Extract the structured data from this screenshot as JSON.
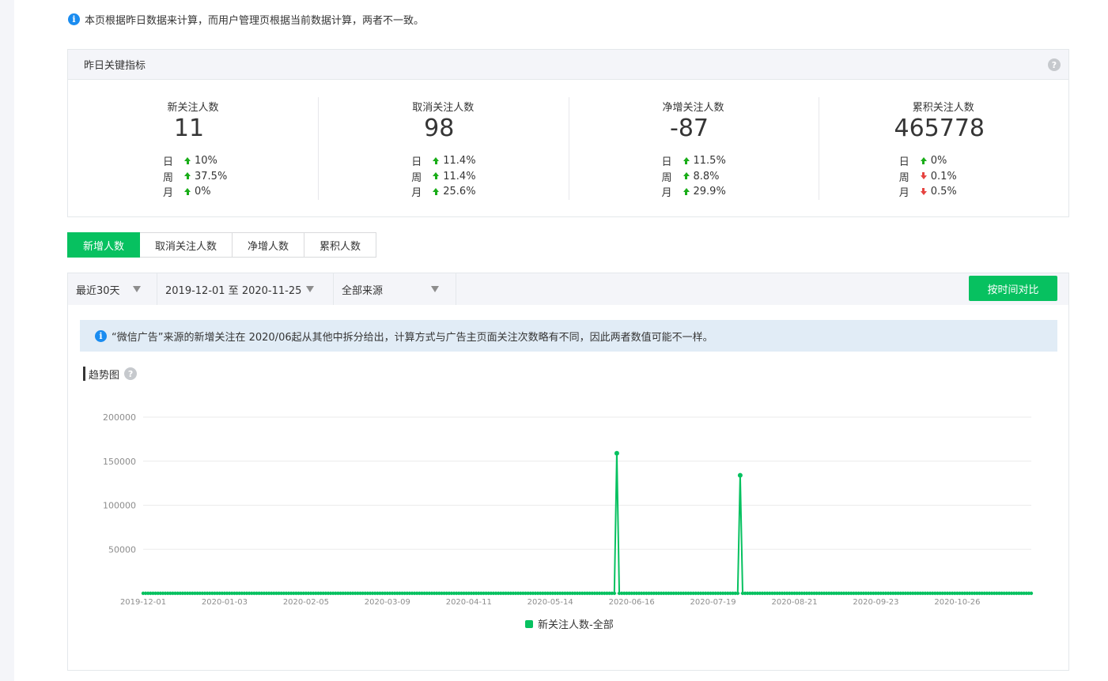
{
  "notice": {
    "text": "本页根据昨日数据来计算，而用户管理页根据当前数据计算，两者不一致。",
    "icon": "info-icon"
  },
  "kpi": {
    "title": "昨日关键指标",
    "help_icon": "question-icon",
    "metrics": [
      {
        "label": "新关注人数",
        "value": "11",
        "stats": [
          {
            "period": "日",
            "direction": "up",
            "change": "10%"
          },
          {
            "period": "周",
            "direction": "up",
            "change": "37.5%"
          },
          {
            "period": "月",
            "direction": "up",
            "change": "0%"
          }
        ]
      },
      {
        "label": "取消关注人数",
        "value": "98",
        "stats": [
          {
            "period": "日",
            "direction": "up",
            "change": "11.4%"
          },
          {
            "period": "周",
            "direction": "up",
            "change": "11.4%"
          },
          {
            "period": "月",
            "direction": "up",
            "change": "25.6%"
          }
        ]
      },
      {
        "label": "净增关注人数",
        "value": "-87",
        "stats": [
          {
            "period": "日",
            "direction": "up",
            "change": "11.5%"
          },
          {
            "period": "周",
            "direction": "up",
            "change": "8.8%"
          },
          {
            "period": "月",
            "direction": "up",
            "change": "29.9%"
          }
        ]
      },
      {
        "label": "累积关注人数",
        "value": "465778",
        "stats": [
          {
            "period": "日",
            "direction": "up",
            "change": "0%"
          },
          {
            "period": "周",
            "direction": "down",
            "change": "0.1%"
          },
          {
            "period": "月",
            "direction": "down",
            "change": "0.5%"
          }
        ]
      }
    ]
  },
  "tabs": [
    {
      "label": "新增人数",
      "active": true
    },
    {
      "label": "取消关注人数",
      "active": false
    },
    {
      "label": "净增人数",
      "active": false
    },
    {
      "label": "累积人数",
      "active": false
    }
  ],
  "filters": {
    "range": "最近30天",
    "dates": "2019-12-01 至 2020-11-25",
    "source": "全部来源",
    "compare_button": "按时间对比"
  },
  "ad_notice": "“微信广告”来源的新增关注在 2020/06起从其他中拆分给出，计算方式与广告主页面关注次数略有不同，因此两者数值可能不一样。",
  "trend_title": "趋势图",
  "colors": {
    "brand_green": "#07c160",
    "up": "#1aad19",
    "down": "#e64340",
    "info_blue": "#1a8cf0"
  },
  "chart_data": {
    "type": "line",
    "title": "",
    "xlabel": "",
    "ylabel": "",
    "x_start": "2019-12-01",
    "x_end": "2020-11-25",
    "x_ticks": [
      "2019-12-01",
      "2020-01-03",
      "2020-02-05",
      "2020-03-09",
      "2020-04-11",
      "2020-05-14",
      "2020-06-16",
      "2020-07-19",
      "2020-08-21",
      "2020-09-23",
      "2020-10-26"
    ],
    "y_ticks": [
      50000,
      100000,
      150000,
      200000
    ],
    "ylim": [
      0,
      200000
    ],
    "grid": true,
    "legend_position": "bottom",
    "series": [
      {
        "name": "新关注人数-全部",
        "baseline": 0,
        "peaks": [
          {
            "date": "2020-06-10",
            "value": 159000
          },
          {
            "date": "2020-07-30",
            "value": 134000
          }
        ]
      }
    ]
  }
}
